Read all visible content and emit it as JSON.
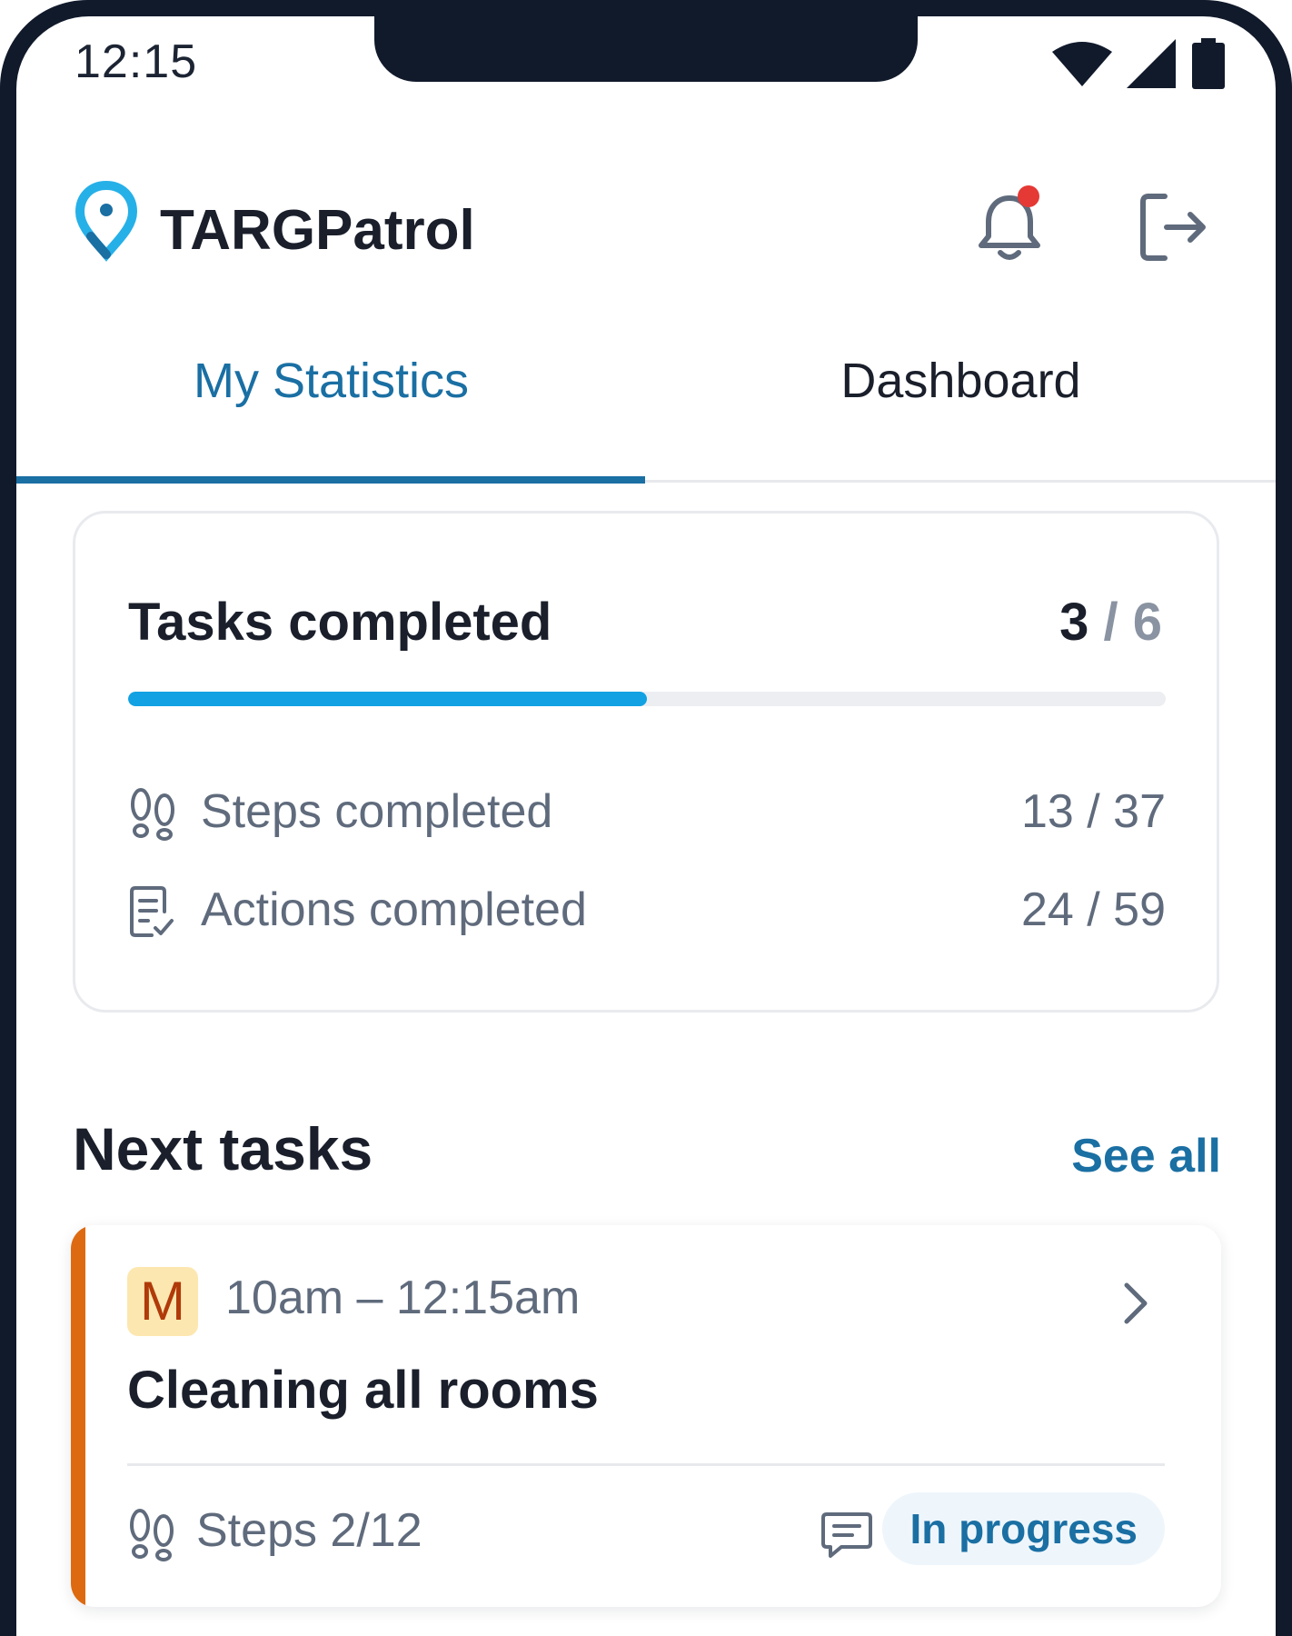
{
  "status_bar": {
    "time": "12:15",
    "icons": [
      "wifi-icon",
      "signal-icon",
      "battery-icon"
    ]
  },
  "header": {
    "app_name": "TARGPatrol",
    "logo_icon": "location-pin-icon",
    "notification_icon": "bell-icon",
    "has_unread_notification": true,
    "logout_icon": "logout-icon"
  },
  "tabs": [
    {
      "label": "My Statistics",
      "active": true
    },
    {
      "label": "Dashboard",
      "active": false
    }
  ],
  "statistics": {
    "tasks_completed": {
      "label": "Tasks completed",
      "done": "3",
      "separator": " / ",
      "total": "6",
      "progress_fraction": 0.5
    },
    "rows": [
      {
        "icon": "footsteps-icon",
        "label": "Steps completed",
        "value": "13 / 37"
      },
      {
        "icon": "checklist-icon",
        "label": "Actions completed",
        "value": "24 / 59"
      }
    ]
  },
  "next_tasks": {
    "title": "Next tasks",
    "see_all": "See all",
    "items": [
      {
        "badge": "M",
        "time": "10am – 12:15am",
        "title": "Cleaning all rooms",
        "steps": "Steps 2/12",
        "status": "In progress",
        "accent_color": "#dd6a11"
      }
    ]
  },
  "colors": {
    "primary": "#1a6fa3",
    "progress": "#12a1e3",
    "notification_dot": "#e53935",
    "frame": "#111a2b"
  }
}
